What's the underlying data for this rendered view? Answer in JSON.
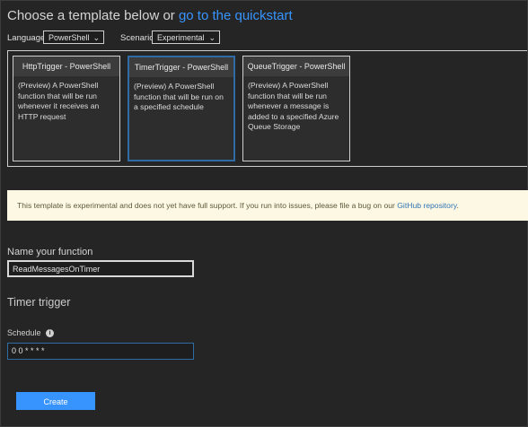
{
  "header": {
    "title": "Choose a template below or",
    "quickstart_link": "go to the quickstart"
  },
  "filters": {
    "language_label": "Language:",
    "language_value": "PowerShell",
    "scenario_label": "Scenario:",
    "scenario_value": "Experimental"
  },
  "templates": [
    {
      "title": "HttpTrigger - PowerShell",
      "description": "(Preview) A PowerShell function that will be run whenever it receives an HTTP request"
    },
    {
      "title": "TimerTrigger - PowerShell",
      "description": "(Preview) A PowerShell function that will be run on a specified schedule"
    },
    {
      "title": "QueueTrigger - PowerShell",
      "description": "(Preview) A PowerShell function that will be run whenever a message is added to a specified Azure Queue Storage"
    }
  ],
  "notice": {
    "text": "This template is experimental and does not yet have full support. If you run into issues, please file a bug on our",
    "link": "GitHub repository",
    "suffix": "."
  },
  "form": {
    "name_heading": "Name your function",
    "name_value": "ReadMessagesOnTimer",
    "section_heading": "Timer trigger",
    "schedule_label": "Schedule",
    "schedule_value": "0 0 * * * *",
    "create_label": "Create"
  },
  "colors": {
    "accent": "#3794ff",
    "selected_border": "#2f6ba5",
    "notice_bg": "#fcf8e3"
  },
  "icons": {
    "info": "info-icon",
    "dropdown": "chevron-down-icon"
  }
}
